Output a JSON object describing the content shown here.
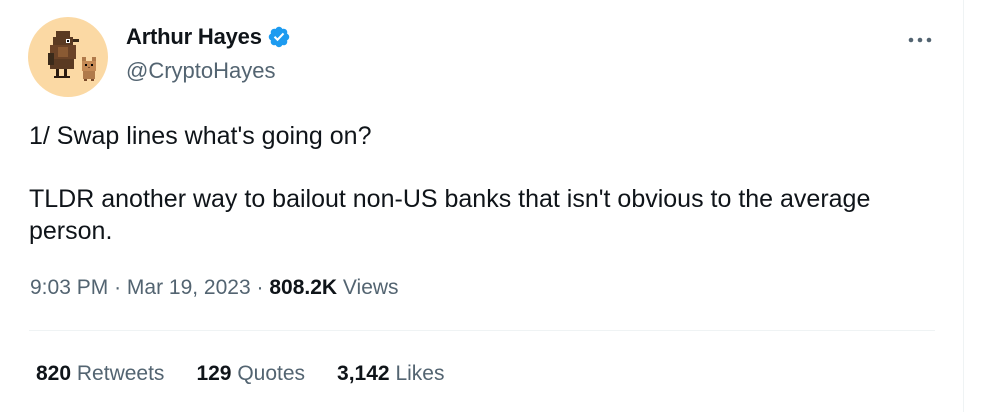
{
  "author": {
    "display_name": "Arthur Hayes",
    "handle": "@CryptoHayes",
    "verified_icon": "verified-badge-icon"
  },
  "tweet": {
    "line1": "1/ Swap lines what's going on?",
    "line2": "TLDR another way to bailout non-US banks that isn't obvious to the average person."
  },
  "meta": {
    "time": "9:03 PM",
    "separator": "·",
    "date": "Mar 19, 2023",
    "views_count": "808.2K",
    "views_label": "Views"
  },
  "stats": [
    {
      "count": "820",
      "label": "Retweets"
    },
    {
      "count": "129",
      "label": "Quotes"
    },
    {
      "count": "3,142",
      "label": "Likes"
    }
  ],
  "icons": {
    "more": "more-options-icon",
    "avatar": "pixel-bird-and-cat-avatar"
  },
  "colors": {
    "text_primary": "#0f1419",
    "text_secondary": "#536471",
    "verified_blue": "#1d9bf0",
    "avatar_bg": "#fbd9a4",
    "divider": "#eff3f4"
  }
}
